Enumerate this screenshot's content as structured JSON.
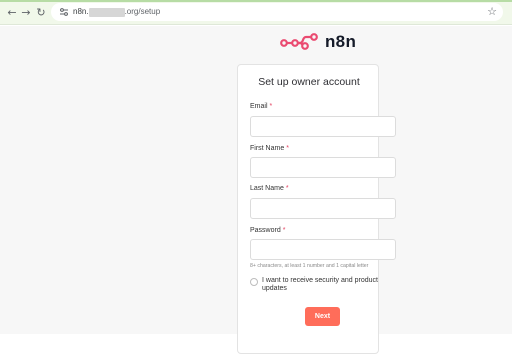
{
  "browser": {
    "url_prefix": "n8n.",
    "url_suffix": ".org/setup",
    "icons": [
      "back-arrow",
      "forward-arrow",
      "reload",
      "site-settings",
      "bookmark-star"
    ]
  },
  "logo": {
    "text": "n8n"
  },
  "card": {
    "title": "Set up owner account",
    "fields": [
      {
        "label": "Email",
        "value": "",
        "required": true
      },
      {
        "label": "First Name",
        "value": "",
        "required": true
      },
      {
        "label": "Last Name",
        "value": "",
        "required": true
      },
      {
        "label": "Password",
        "value": "",
        "required": true
      }
    ],
    "required_marker": "*",
    "password_hint": "8+ characters, at least 1 number and 1 capital letter",
    "checkbox_label": "I want to receive security and product updates",
    "next_label": "Next"
  },
  "colors": {
    "accent": "#ff6d5a",
    "required": "#e4405f",
    "logo": "#ea4b71"
  }
}
